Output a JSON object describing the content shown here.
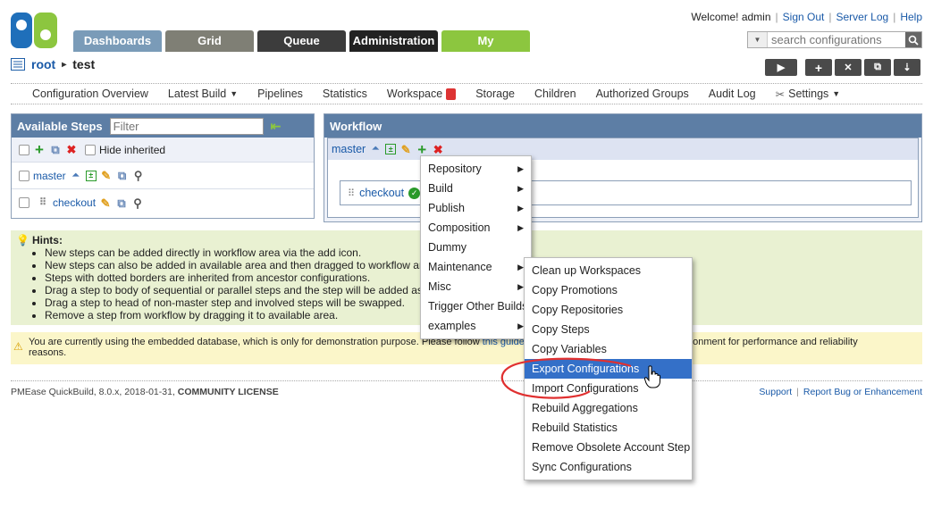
{
  "header": {
    "logo_text": "qb",
    "tabs": [
      {
        "label": "Dashboards",
        "color": "#7a9bb8"
      },
      {
        "label": "Grid",
        "color": "#7f7f75"
      },
      {
        "label": "Queue",
        "color": "#3c3c3c"
      },
      {
        "label": "Administration",
        "color": "#222222"
      },
      {
        "label": "My",
        "color": "#8cc63f"
      }
    ],
    "welcome": "Welcome! admin",
    "sign_out": "Sign Out",
    "server_log": "Server Log",
    "help": "Help",
    "search_placeholder": "search configurations"
  },
  "breadcrumb": {
    "root": "root",
    "sep": "▸",
    "current": "test"
  },
  "nav": {
    "items": [
      "Configuration Overview",
      "Latest Build",
      "Pipelines",
      "Statistics",
      "Workspace",
      "Storage",
      "Children",
      "Authorized Groups",
      "Audit Log",
      "Settings"
    ]
  },
  "available_steps": {
    "title": "Available Steps",
    "filter_placeholder": "Filter",
    "hide_inherited": "Hide inherited",
    "steps": [
      "master",
      "checkout"
    ]
  },
  "workflow": {
    "title": "Workflow",
    "master": "master",
    "checkout": "checkout"
  },
  "hints": {
    "title": "Hints:",
    "items": [
      "New steps can be added directly in workflow area via the add icon.",
      "New steps can also be added in available area and then dragged to workflow are",
      "Steps with dotted borders are inherited from ancestor configurations.",
      "Drag a step to body of sequential or parallel steps and the step will be added as",
      "Drag a step to head of non-master step and involved steps will be swapped.",
      "Remove a step from workflow by dragging it to available area."
    ]
  },
  "warning": {
    "text1": "You are currently using the embedded database, which is only for demonstration purpose. Please follow",
    "link": "this guide",
    "text2": "uction environment for performance and reliability",
    "text3": "reasons."
  },
  "footer": {
    "product": "PMEase QuickBuild",
    "version": ", 8.0.x, 2018-01-31,",
    "license": "COMMUNITY LICENSE",
    "support": "Support",
    "report": "Report Bug or Enhancement"
  },
  "menu": {
    "items": [
      "Repository",
      "Build",
      "Publish",
      "Composition",
      "Dummy",
      "Maintenance",
      "Misc",
      "Trigger Other Builds",
      "examples"
    ],
    "has_submenu": [
      true,
      true,
      true,
      true,
      false,
      true,
      true,
      false,
      true
    ]
  },
  "submenu": {
    "items": [
      "Clean up Workspaces",
      "Copy Promotions",
      "Copy Repositories",
      "Copy Steps",
      "Copy Variables",
      "Export Configurations",
      "Import Configurations",
      "Rebuild Aggregations",
      "Rebuild Statistics",
      "Remove Obsolete Account Step",
      "Sync Configurations"
    ],
    "selected": "Export Configurations"
  },
  "colors": {
    "accent": "#5d7ea5",
    "selection": "#3470c8",
    "annotation": "#e03030"
  }
}
